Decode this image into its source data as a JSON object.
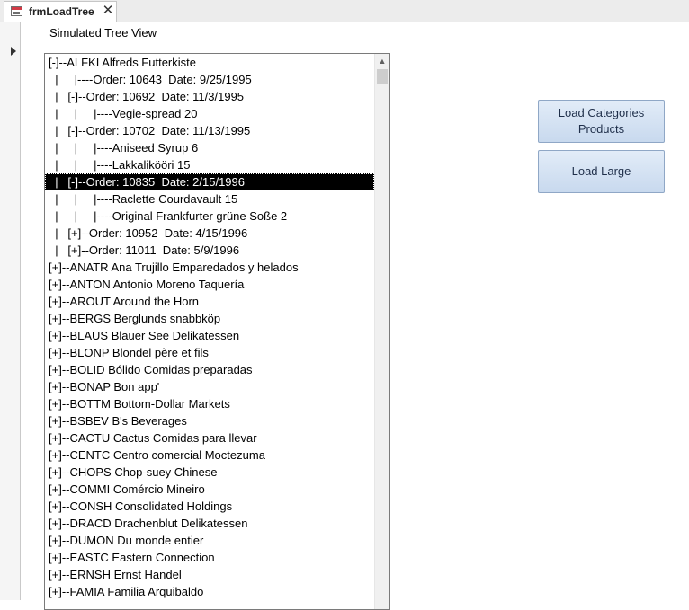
{
  "tab": {
    "title": "frmLoadTree",
    "close_glyph": "✕",
    "icon": "form-icon"
  },
  "form": {
    "label": "Simulated Tree View"
  },
  "tree": {
    "selected_index": 7,
    "rows": [
      "[-]--ALFKI Alfreds Futterkiste",
      "  |     |----Order: 10643  Date: 9/25/1995",
      "  |   [-]--Order: 10692  Date: 11/3/1995",
      "  |     |     |----Vegie-spread 20",
      "  |   [-]--Order: 10702  Date: 11/13/1995",
      "  |     |     |----Aniseed Syrup 6",
      "  |     |     |----Lakkalikööri 15",
      "  |   [-]--Order: 10835  Date: 2/15/1996",
      "  |     |     |----Raclette Courdavault 15",
      "  |     |     |----Original Frankfurter grüne Soße 2",
      "  |   [+]--Order: 10952  Date: 4/15/1996",
      "  |   [+]--Order: 11011  Date: 5/9/1996",
      "[+]--ANATR Ana Trujillo Emparedados y helados",
      "[+]--ANTON Antonio Moreno Taquería",
      "[+]--AROUT Around the Horn",
      "[+]--BERGS Berglunds snabbköp",
      "[+]--BLAUS Blauer See Delikatessen",
      "[+]--BLONP Blondel père et fils",
      "[+]--BOLID Bólido Comidas preparadas",
      "[+]--BONAP Bon app'",
      "[+]--BOTTM Bottom-Dollar Markets",
      "[+]--BSBEV B's Beverages",
      "[+]--CACTU Cactus Comidas para llevar",
      "[+]--CENTC Centro comercial Moctezuma",
      "[+]--CHOPS Chop-suey Chinese",
      "[+]--COMMI Comércio Mineiro",
      "[+]--CONSH Consolidated Holdings",
      "[+]--DRACD Drachenblut Delikatessen",
      "[+]--DUMON Du monde entier",
      "[+]--EASTC Eastern Connection",
      "[+]--ERNSH Ernst Handel",
      "[+]--FAMIA Familia Arquibaldo"
    ]
  },
  "scrollbar": {
    "up_glyph": "▲"
  },
  "buttons": {
    "load_categories": "Load Categories\nProducts",
    "load_large": "Load Large"
  },
  "colors": {
    "button_face": "#d6e3f3",
    "selection": "#000000"
  }
}
